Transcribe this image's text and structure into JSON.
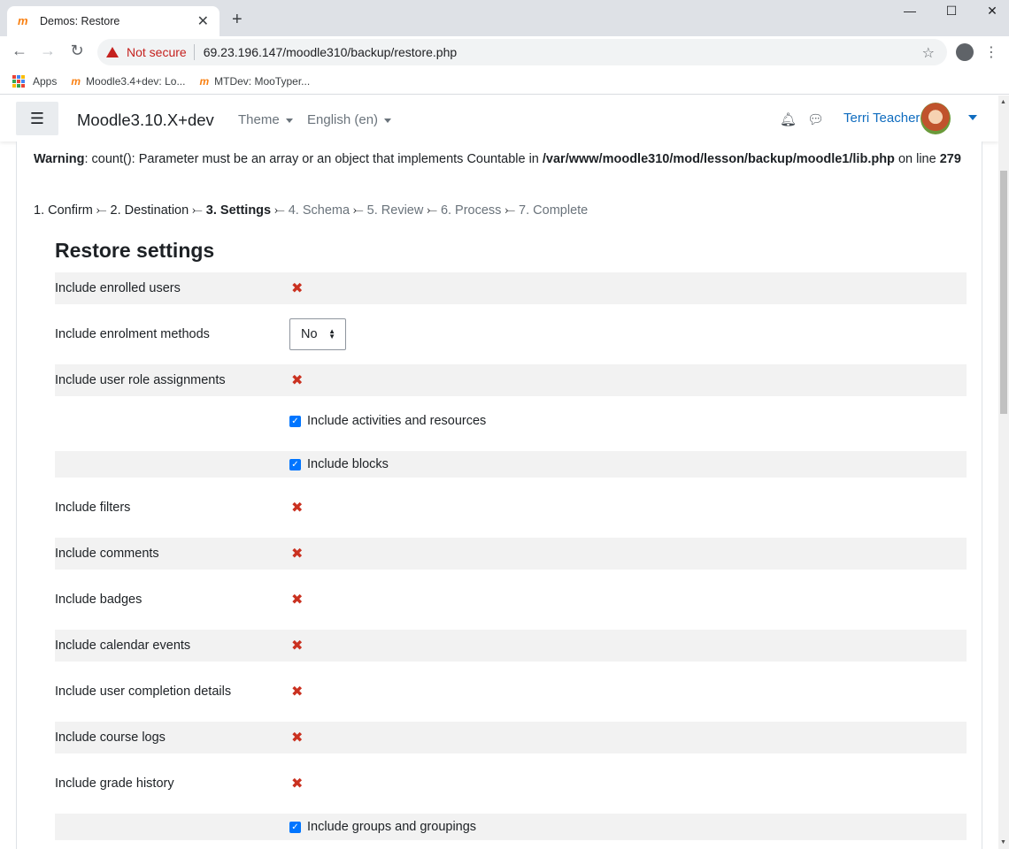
{
  "browser": {
    "tab_title": "Demos: Restore",
    "tab_favicon": "moodle-icon",
    "new_tab": "+",
    "security_label": "Not secure",
    "url": "69.23.196.147/moodle310/backup/restore.php",
    "bookmarks": [
      {
        "label": "Apps",
        "icon": "apps-grid-icon"
      },
      {
        "label": "Moodle3.4+dev: Lo...",
        "icon": "moodle-icon"
      },
      {
        "label": "MTDev: MooTyper...",
        "icon": "moodle-icon"
      }
    ]
  },
  "navbar": {
    "site_name": "Moodle3.10.X+dev",
    "menu_theme": "Theme",
    "menu_language": "English (en)",
    "user_name": "Terri Teacher",
    "accent_color": "#0f6cbf"
  },
  "warning": {
    "label": "Warning",
    "message": ": count(): Parameter must be an array or an object that implements Countable in ",
    "path": "/var/www/moodle310/mod/lesson/backup/moodle1/lib.php",
    "suffix": " on line ",
    "line": "279"
  },
  "steps": [
    {
      "label": "1. Confirm",
      "state": "done"
    },
    {
      "label": "2. Destination",
      "state": "done"
    },
    {
      "label": "3. Settings",
      "state": "current"
    },
    {
      "label": "4. Schema",
      "state": "pending"
    },
    {
      "label": "5. Review",
      "state": "pending"
    },
    {
      "label": "6. Process",
      "state": "pending"
    },
    {
      "label": "7. Complete",
      "state": "pending"
    }
  ],
  "restore": {
    "heading": "Restore settings",
    "rows": {
      "enrolled_users": {
        "label": "Include enrolled users"
      },
      "enrolment_methods": {
        "label": "Include enrolment methods",
        "value": "No"
      },
      "role_assignments": {
        "label": "Include user role assignments"
      },
      "activities": {
        "label": "Include activities and resources",
        "checked": true
      },
      "blocks": {
        "label": "Include blocks",
        "checked": true
      },
      "filters": {
        "label": "Include filters"
      },
      "comments": {
        "label": "Include comments"
      },
      "badges": {
        "label": "Include badges"
      },
      "calendar": {
        "label": "Include calendar events"
      },
      "completion": {
        "label": "Include user completion details"
      },
      "logs": {
        "label": "Include course logs"
      },
      "grade_history": {
        "label": "Include grade history"
      },
      "groups": {
        "label": "Include groups and groupings",
        "checked": true
      }
    },
    "disabled_mark": "✖",
    "disabled_color": "#ca3120"
  }
}
